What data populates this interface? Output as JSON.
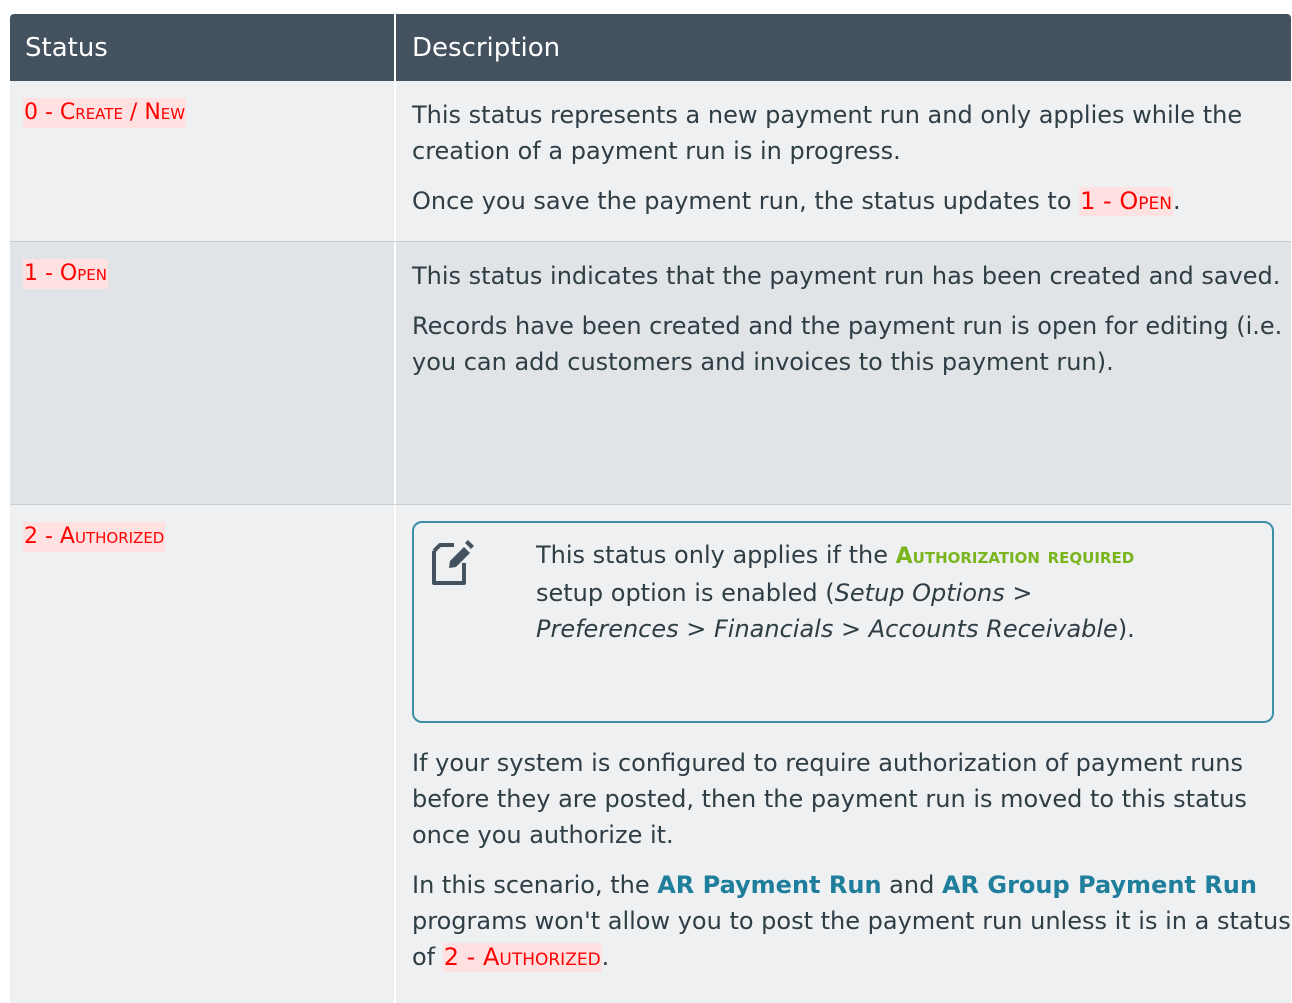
{
  "header": {
    "status": "Status",
    "description": "Description"
  },
  "rows": [
    {
      "status_num": "0 - ",
      "status_word": "Create / New",
      "p1": "This status represents a new payment run and only applies while the creation of a payment run is in progress.",
      "p2_pre": "Once you save the payment run, the status updates to ",
      "p2_status_num": "1 - ",
      "p2_status_word": "Open",
      "p2_post": "."
    },
    {
      "status_num": "1 - ",
      "status_word": "Open",
      "p1": "This status indicates that the payment run has been created and saved.",
      "p2": "Records have been created and the payment run is open for editing (i.e. you can add customers and invoices to this payment run)."
    },
    {
      "status_num": "2 - ",
      "status_word": "Authorized",
      "note": {
        "pre": "This status only applies if the ",
        "setting": "Authorization required",
        "mid": " setup option is enabled (",
        "path": "Setup Options > Preferences > Financials > Accounts Receivable",
        "post": ")."
      },
      "p1": "If your system is configured to require authorization of payment runs before they are posted, then the payment run is moved to this status once you authorize it.",
      "p2_pre": "In this scenario, the ",
      "prog1": "AR Payment Run",
      "p2_and": " and ",
      "prog2": "AR Group Payment Run",
      "p2_mid": " programs won't allow you to post the payment run unless it is in a status of ",
      "p2_status_num": "2 - ",
      "p2_status_word": "Authorized",
      "p2_post": "."
    }
  ],
  "colors": {
    "header_bg": "#44525f",
    "status_red": "#ff0000",
    "highlight": "#ffe1e1",
    "link_teal": "#1f7e9c",
    "setting_green": "#7ab51d",
    "note_border": "#3d8fa8"
  },
  "icons": {
    "note": "note-edit-icon"
  }
}
